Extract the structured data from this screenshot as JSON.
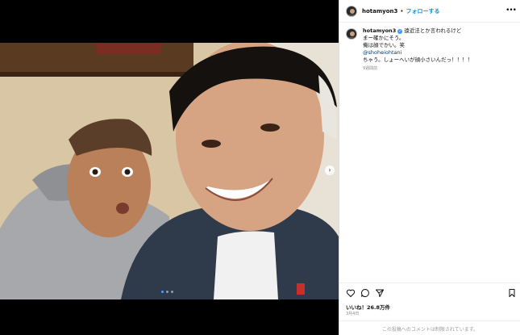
{
  "post": {
    "username": "hotamyon3",
    "separator": "•",
    "follow_label": "フォローする",
    "more_label": "•••",
    "caption": {
      "username": "hotamyon3",
      "line1": "遠近法とか言われるけど",
      "line2": "まー確かにそう。",
      "line3": "俺は顔でかい。笑",
      "mention": "@shoheiohtani",
      "line5": "ちゃう。しょーへいが顔小さいんだっ！！！！",
      "time": "9週間前"
    },
    "likes": "いいね！26.8万件",
    "date": "3月4日",
    "comments_note": "この投稿へのコメントは制限されています。"
  },
  "icons": {
    "heart": "heart-icon",
    "comment": "comment-icon",
    "share": "share-icon",
    "bookmark": "bookmark-icon",
    "next": "chevron-right-icon"
  },
  "carousel": {
    "count": 3,
    "active_index": 0
  }
}
